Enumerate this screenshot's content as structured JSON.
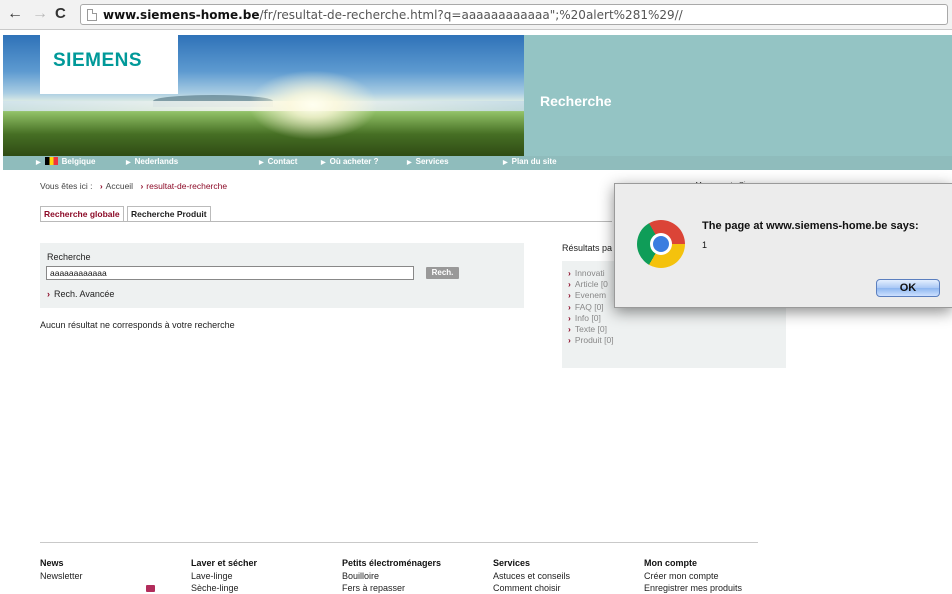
{
  "browser": {
    "url_host": "www.siemens-home.be",
    "url_path": "/fr/resultat-de-recherche.html?q=aaaaaaaaaaaa\";%20alert%281%29//"
  },
  "header": {
    "logo": "SIEMENS",
    "section_title": "Recherche"
  },
  "nav": {
    "items": [
      "Belgique",
      "Nederlands",
      "Contact",
      "Où acheter ?",
      "Services",
      "Plan du site"
    ]
  },
  "breadcrumb": {
    "prefix": "Vous êtes ici :",
    "home": "Accueil",
    "current": "resultat-de-recherche"
  },
  "account_link": "Mon compte Siemens",
  "tabs": [
    "Recherche globale",
    "Recherche Produit"
  ],
  "search": {
    "label": "Recherche",
    "value": "aaaaaaaaaaaa",
    "button": "Rech.",
    "advanced": "Rech. Avancée"
  },
  "no_result": "Aucun résultat ne corresponds à votre recherche",
  "results": {
    "title": "Résultats pa",
    "items": [
      "Innovati",
      "Article [0",
      "Evenem",
      "FAQ [0]",
      "Info [0]",
      "Texte [0]",
      "Produit [0]"
    ]
  },
  "footer": {
    "columns": [
      {
        "heading": "News",
        "links": [
          "Newsletter"
        ]
      },
      {
        "heading": "Laver et sécher",
        "links": [
          "Lave-linge",
          "Sèche-linge"
        ]
      },
      {
        "heading": "Petits électroménagers",
        "links": [
          "Bouilloire",
          "Fers à repasser"
        ]
      },
      {
        "heading": "Services",
        "links": [
          "Astuces et conseils",
          "Comment choisir"
        ]
      },
      {
        "heading": "Mon compte",
        "links": [
          "Créer mon compte",
          "Enregistrer mes produits"
        ]
      }
    ]
  },
  "alert": {
    "title": "The page at www.siemens-home.be says:",
    "message": "1",
    "ok": "OK"
  },
  "colors": {
    "brand_teal": "#009999",
    "accent_red": "#8c0a27",
    "teal_panel": "#94c4c4"
  }
}
